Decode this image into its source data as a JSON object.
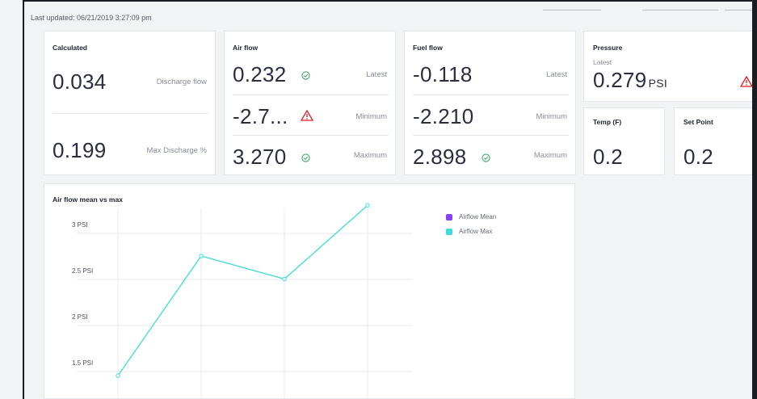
{
  "header": {
    "last_updated": "Last updated: 06/21/2019 3:27:09 pm"
  },
  "calculated": {
    "title": "Calculated",
    "rows": [
      {
        "value": "0.034",
        "label": "Discharge flow"
      },
      {
        "value": "0.199",
        "label": "Max Discharge %"
      }
    ]
  },
  "air_flow": {
    "title": "Air flow",
    "rows": [
      {
        "value": "0.232",
        "label": "Latest",
        "status": "ok"
      },
      {
        "value": "-2.7...",
        "label": "Minimum",
        "status": "warning"
      },
      {
        "value": "3.270",
        "label": "Maximum",
        "status": "ok"
      }
    ]
  },
  "fuel_flow": {
    "title": "Fuel flow",
    "rows": [
      {
        "value": "-0.118",
        "label": "Latest"
      },
      {
        "value": "-2.210",
        "label": "Minimum"
      },
      {
        "value": "2.898",
        "label": "Maximum",
        "status": "ok"
      }
    ]
  },
  "pressure": {
    "title": "Pressure",
    "sub": "Latest",
    "value": "0.279",
    "unit": "PSI",
    "status": "warning"
  },
  "temp": {
    "title": "Temp (F)",
    "value": "0.2"
  },
  "set_point": {
    "title": "Set Point",
    "value": "0.2"
  },
  "colors": {
    "ok": "#3fa86b",
    "warning": "#da1e28",
    "airflow_mean": "#8a3ffc",
    "airflow_max": "#3ddbd9"
  },
  "chart_data": {
    "type": "line",
    "title": "Air flow mean vs max",
    "ytick_labels": [
      "3 PSI",
      "2.5 PSI",
      "2 PSI",
      "1.5 PSI"
    ],
    "yticks": [
      3,
      2.5,
      2,
      1.5
    ],
    "series": [
      {
        "name": "Airflow Mean",
        "x": [],
        "values": []
      },
      {
        "name": "Airflow Max",
        "x": [
          1,
          2,
          3,
          4
        ],
        "values": [
          1.42,
          2.72,
          2.47,
          3.27
        ]
      }
    ],
    "legend": "top-right",
    "grid": true
  }
}
